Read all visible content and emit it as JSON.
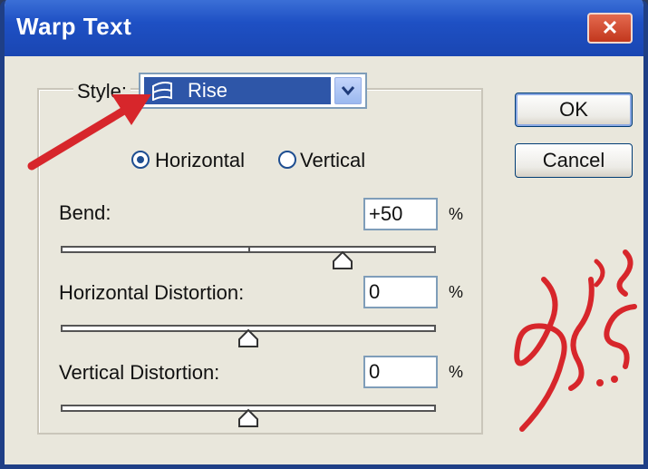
{
  "window": {
    "title": "Warp Text",
    "close_label": "✕"
  },
  "style": {
    "label": "Style:",
    "selected": "Rise"
  },
  "orientation": {
    "horizontal": "Horizontal",
    "vertical": "Vertical",
    "selected": "horizontal"
  },
  "bend": {
    "label": "Bend:",
    "value": "+50",
    "unit": "%",
    "slider_fraction": 0.75
  },
  "hdist": {
    "label": "Horizontal Distortion:",
    "value": "0",
    "unit": "%",
    "slider_fraction": 0.5
  },
  "vdist": {
    "label": "Vertical Distortion:",
    "value": "0",
    "unit": "%",
    "slider_fraction": 0.5
  },
  "buttons": {
    "ok": "OK",
    "cancel": "Cancel"
  },
  "annotation": {
    "arrow_color": "#d7262b",
    "watermark_text": "خطى علم"
  }
}
